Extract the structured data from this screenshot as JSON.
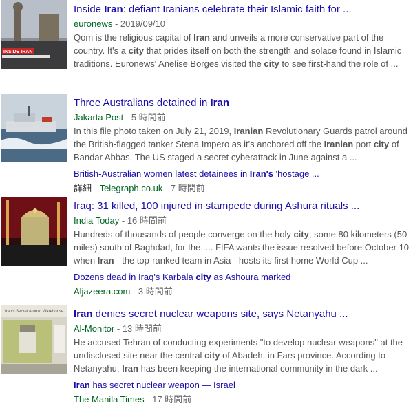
{
  "results": [
    {
      "title_pre": "Inside ",
      "title_bold": "Iran",
      "title_post": ": defiant Iranians celebrate their Islamic faith for ...",
      "source": "euronews",
      "time": " - 2019/09/10",
      "snippet": [
        {
          "t": "Qom is the religious capital of "
        },
        {
          "b": "Iran"
        },
        {
          "t": " and unveils a more conservative part of the country. It's a "
        },
        {
          "b": "city"
        },
        {
          "t": " that prides itself on both the strength and solace found in Islamic traditions. Euronews' Anelise Borges visited the "
        },
        {
          "b": "city"
        },
        {
          "t": " to see first-hand the role of ..."
        }
      ],
      "thumb_caption": "INSIDE IRAN"
    },
    {
      "title_pre": "Three Australians detained in ",
      "title_bold": "Iran",
      "title_post": "",
      "source": "Jakarta Post",
      "time": " - 5 時間前",
      "snippet": [
        {
          "t": "In this file photo taken on July 21, 2019, "
        },
        {
          "b": "Iranian"
        },
        {
          "t": " Revolutionary Guards patrol around the British-flagged tanker Stena Impero as it's anchored off the "
        },
        {
          "b": "Iranian"
        },
        {
          "t": " port "
        },
        {
          "b": "city"
        },
        {
          "t": " of Bandar Abbas. The US staged a secret cyberattack in June against a ..."
        }
      ],
      "sub_title": [
        {
          "t": "British-Australian women latest detainees in "
        },
        {
          "b": "Iran's"
        },
        {
          "t": " 'hostage ..."
        }
      ],
      "sub_more": "詳細 - ",
      "sub_source": "Telegraph.co.uk",
      "sub_time": " - 7 時間前"
    },
    {
      "title_pre": "Iraq: 31 killed, 100 injured in stampede during Ashura rituals ...",
      "title_bold": "",
      "title_post": "",
      "source": "India Today",
      "time": " - 16 時間前",
      "snippet": [
        {
          "t": "Hundreds of thousands of people converge on the holy "
        },
        {
          "b": "city"
        },
        {
          "t": ", some 80 kilometers (50 miles) south of Baghdad, for the .... FIFA wants the issue resolved before October 10 when "
        },
        {
          "b": "Iran"
        },
        {
          "t": " - the top-ranked team in Asia - hosts its first home World Cup ..."
        }
      ],
      "sub_title": [
        {
          "t": "Dozens dead in Iraq's Karbala "
        },
        {
          "b": "city"
        },
        {
          "t": " as Ashoura marked"
        }
      ],
      "sub_more": "",
      "sub_source": "Aljazeera.com",
      "sub_time": " - 3 時間前"
    },
    {
      "title_pre": "",
      "title_bold": "Iran",
      "title_post": " denies secret nuclear weapons site, says Netanyahu ...",
      "source": "Al-Monitor",
      "time": " - 13 時間前",
      "snippet": [
        {
          "t": "He accused Tehran of conducting experiments \"to develop nuclear weapons\" at the undisclosed site near the central "
        },
        {
          "b": "city"
        },
        {
          "t": " of Abadeh, in Fars province. According to Netanyahu, "
        },
        {
          "b": "Iran"
        },
        {
          "t": " has been keeping the international community in the dark ..."
        }
      ],
      "sub_title": [
        {
          "b": "Iran"
        },
        {
          "t": " has secret nuclear weapon — Israel"
        }
      ],
      "sub_more": "",
      "sub_source": "The Manila Times",
      "sub_time": " - 17 時間前",
      "thumb_caption": "Iran's Secret Atomic Warehouse"
    }
  ]
}
